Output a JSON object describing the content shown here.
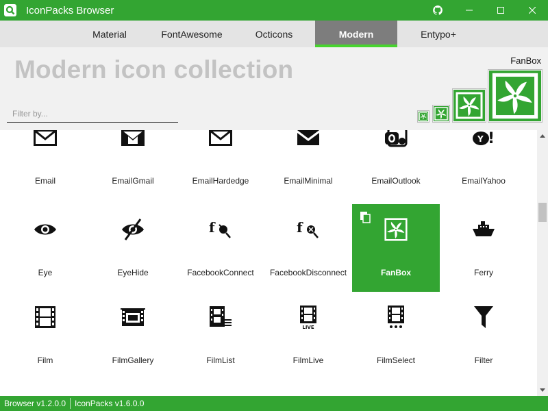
{
  "window": {
    "title": "IconPacks Browser",
    "accent_color": "#33a532",
    "icons": [
      "app-logo-icon",
      "github-icon",
      "minimize-icon",
      "maximize-icon",
      "close-icon"
    ]
  },
  "tabs": [
    {
      "label": "Material",
      "active": false
    },
    {
      "label": "FontAwesome",
      "active": false
    },
    {
      "label": "Octicons",
      "active": false
    },
    {
      "label": "Modern",
      "active": true
    },
    {
      "label": "Entypo+",
      "active": false
    }
  ],
  "header": {
    "title": "Modern icon collection",
    "filter_placeholder": "Filter by...",
    "selected_icon_name": "FanBox"
  },
  "icons": [
    {
      "name": "Email",
      "icon": "email"
    },
    {
      "name": "EmailGmail",
      "icon": "email-gmail"
    },
    {
      "name": "EmailHardedge",
      "icon": "email-hardedge"
    },
    {
      "name": "EmailMinimal",
      "icon": "email-minimal"
    },
    {
      "name": "EmailOutlook",
      "icon": "email-outlook"
    },
    {
      "name": "EmailYahoo",
      "icon": "email-yahoo"
    },
    {
      "name": "Eye",
      "icon": "eye"
    },
    {
      "name": "EyeHide",
      "icon": "eye-hide"
    },
    {
      "name": "FacebookConnect",
      "icon": "facebook-connect"
    },
    {
      "name": "FacebookDisconnect",
      "icon": "facebook-disconnect"
    },
    {
      "name": "FanBox",
      "icon": "fan-box",
      "selected": true
    },
    {
      "name": "Ferry",
      "icon": "ferry"
    },
    {
      "name": "Film",
      "icon": "film"
    },
    {
      "name": "FilmGallery",
      "icon": "film-gallery"
    },
    {
      "name": "FilmList",
      "icon": "film-list"
    },
    {
      "name": "FilmLive",
      "icon": "film-live"
    },
    {
      "name": "FilmSelect",
      "icon": "film-select"
    },
    {
      "name": "Filter",
      "icon": "filter"
    }
  ],
  "status": {
    "browser_version": "Browser v1.2.0.0",
    "iconpacks_version": "IconPacks v1.6.0.0"
  }
}
